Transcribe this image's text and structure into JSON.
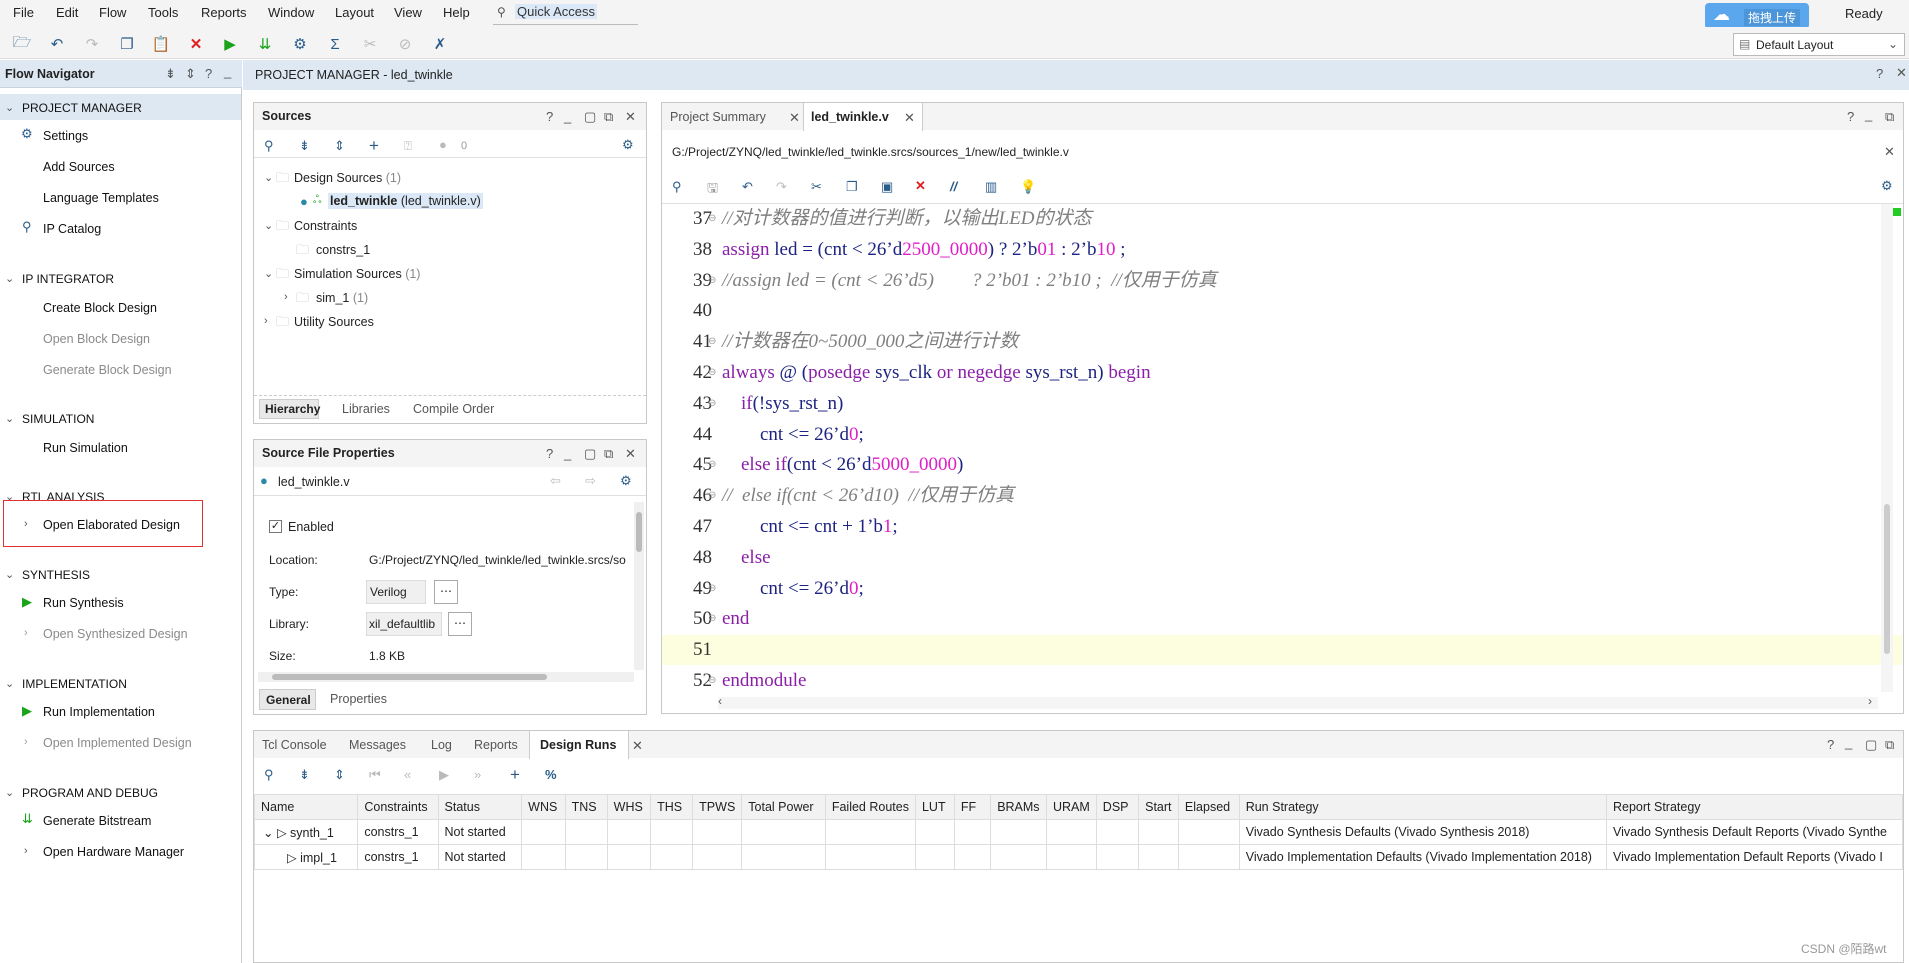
{
  "menu": [
    "File",
    "Edit",
    "Flow",
    "Tools",
    "Reports",
    "Window",
    "Layout",
    "View",
    "Help"
  ],
  "quick_access": "Quick Access",
  "status": "Ready",
  "upload_label": "拖拽上传",
  "layout_select": "Default Layout",
  "flow_nav": {
    "title": "Flow Navigator",
    "sections": [
      {
        "label": "PROJECT MANAGER",
        "items": [
          "Settings",
          "Add Sources",
          "Language Templates",
          "IP Catalog"
        ]
      },
      {
        "label": "IP INTEGRATOR",
        "items": [
          "Create Block Design",
          "Open Block Design",
          "Generate Block Design"
        ]
      },
      {
        "label": "SIMULATION",
        "items": [
          "Run Simulation"
        ]
      },
      {
        "label": "RTL ANALYSIS",
        "items": [
          "Open Elaborated Design"
        ]
      },
      {
        "label": "SYNTHESIS",
        "items": [
          "Run Synthesis",
          "Open Synthesized Design"
        ]
      },
      {
        "label": "IMPLEMENTATION",
        "items": [
          "Run Implementation",
          "Open Implemented Design"
        ]
      },
      {
        "label": "PROGRAM AND DEBUG",
        "items": [
          "Generate Bitstream",
          "Open Hardware Manager"
        ]
      }
    ]
  },
  "pm_title": "PROJECT MANAGER - led_twinkle",
  "sources": {
    "title": "Sources",
    "count": "0",
    "design_sources": "Design Sources",
    "design_count": "(1)",
    "top_module": "led_twinkle",
    "top_file": "(led_twinkle.v)",
    "constraints": "Constraints",
    "constrs": "constrs_1",
    "sim_sources": "Simulation Sources",
    "sim_count": "(1)",
    "sim_1": "sim_1",
    "sim_1_count": "(1)",
    "utility": "Utility Sources",
    "tabs": [
      "Hierarchy",
      "Libraries",
      "Compile Order"
    ]
  },
  "sfp": {
    "title": "Source File Properties",
    "file": "led_twinkle.v",
    "enabled": "Enabled",
    "location_label": "Location:",
    "location": "G:/Project/ZYNQ/led_twinkle/led_twinkle.srcs/so",
    "type_label": "Type:",
    "type": "Verilog",
    "library_label": "Library:",
    "library": "xil_defaultlib",
    "size_label": "Size:",
    "size": "1.8 KB",
    "tabs": [
      "General",
      "Properties"
    ]
  },
  "editor": {
    "tabs": [
      "Project Summary",
      "led_twinkle.v"
    ],
    "path": "G:/Project/ZYNQ/led_twinkle/led_twinkle.srcs/sources_1/new/led_twinkle.v",
    "lines": [
      {
        "n": "37",
        "segs": [
          [
            "cm",
            "//对计数器的值进行判断，以输出LED的状态"
          ]
        ]
      },
      {
        "n": "38",
        "segs": [
          [
            "kw",
            "assign"
          ],
          [
            "plain",
            " led = (cnt < 26’d"
          ],
          [
            "num",
            "2500_0000"
          ],
          [
            "plain",
            ") ? 2’b"
          ],
          [
            "num",
            "01"
          ],
          [
            "plain",
            " : 2’b"
          ],
          [
            "num",
            "10"
          ],
          [
            "plain",
            " ;"
          ]
        ]
      },
      {
        "n": "39",
        "segs": [
          [
            "cm",
            "//assign led = (cnt < 26’d5)        ? 2’b01 : 2’b10 ;  //仅用于仿真"
          ]
        ]
      },
      {
        "n": "40",
        "segs": []
      },
      {
        "n": "41",
        "segs": [
          [
            "cm",
            "//计数器在0~5000_000之间进行计数"
          ]
        ]
      },
      {
        "n": "42",
        "segs": [
          [
            "kw",
            "always"
          ],
          [
            "plain",
            " @ ("
          ],
          [
            "kw",
            "posedge"
          ],
          [
            "plain",
            " sys_clk "
          ],
          [
            "kw",
            "or"
          ],
          [
            "plain",
            " "
          ],
          [
            "kw",
            "negedge"
          ],
          [
            "plain",
            " sys_rst_n) "
          ],
          [
            "kw",
            "begin"
          ]
        ]
      },
      {
        "n": "43",
        "segs": [
          [
            "plain",
            "    "
          ],
          [
            "kw",
            "if"
          ],
          [
            "plain",
            "(!sys_rst_n)"
          ]
        ]
      },
      {
        "n": "44",
        "segs": [
          [
            "plain",
            "        cnt <= 26’d"
          ],
          [
            "num",
            "0"
          ],
          [
            "plain",
            ";"
          ]
        ]
      },
      {
        "n": "45",
        "segs": [
          [
            "plain",
            "    "
          ],
          [
            "kw",
            "else if"
          ],
          [
            "plain",
            "(cnt < 26’d"
          ],
          [
            "num",
            "5000_0000"
          ],
          [
            "plain",
            ")"
          ]
        ]
      },
      {
        "n": "46",
        "segs": [
          [
            "cm",
            "//  else if(cnt < 26’d10)  //仅用于仿真"
          ]
        ]
      },
      {
        "n": "47",
        "segs": [
          [
            "plain",
            "        cnt <= cnt + 1’b"
          ],
          [
            "num",
            "1"
          ],
          [
            "plain",
            ";"
          ]
        ]
      },
      {
        "n": "48",
        "segs": [
          [
            "plain",
            "    "
          ],
          [
            "kw",
            "else"
          ]
        ]
      },
      {
        "n": "49",
        "segs": [
          [
            "plain",
            "        cnt <= 26’d"
          ],
          [
            "num",
            "0"
          ],
          [
            "plain",
            ";"
          ]
        ]
      },
      {
        "n": "50",
        "segs": [
          [
            "kw",
            "end"
          ]
        ]
      },
      {
        "n": "51",
        "segs": []
      },
      {
        "n": "52",
        "segs": [
          [
            "kw",
            "endmodule"
          ]
        ]
      }
    ]
  },
  "bottom": {
    "tabs": [
      "Tcl Console",
      "Messages",
      "Log",
      "Reports",
      "Design Runs"
    ],
    "columns": [
      "Name",
      "Constraints",
      "Status",
      "WNS",
      "TNS",
      "WHS",
      "THS",
      "TPWS",
      "Total Power",
      "Failed Routes",
      "LUT",
      "FF",
      "BRAMs",
      "URAM",
      "DSP",
      "Start",
      "Elapsed",
      "Run Strategy",
      "Report Strategy"
    ],
    "rows": [
      {
        "name": "synth_1",
        "constraints": "constrs_1",
        "status": "Not started",
        "run_strategy": "Vivado Synthesis Defaults (Vivado Synthesis 2018)",
        "report_strategy": "Vivado Synthesis Default Reports (Vivado Synthe"
      },
      {
        "name": "impl_1",
        "constraints": "constrs_1",
        "status": "Not started",
        "run_strategy": "Vivado Implementation Defaults (Vivado Implementation 2018)",
        "report_strategy": "Vivado Implementation Default Reports (Vivado I"
      }
    ]
  },
  "watermark": "CSDN @陌路wt"
}
